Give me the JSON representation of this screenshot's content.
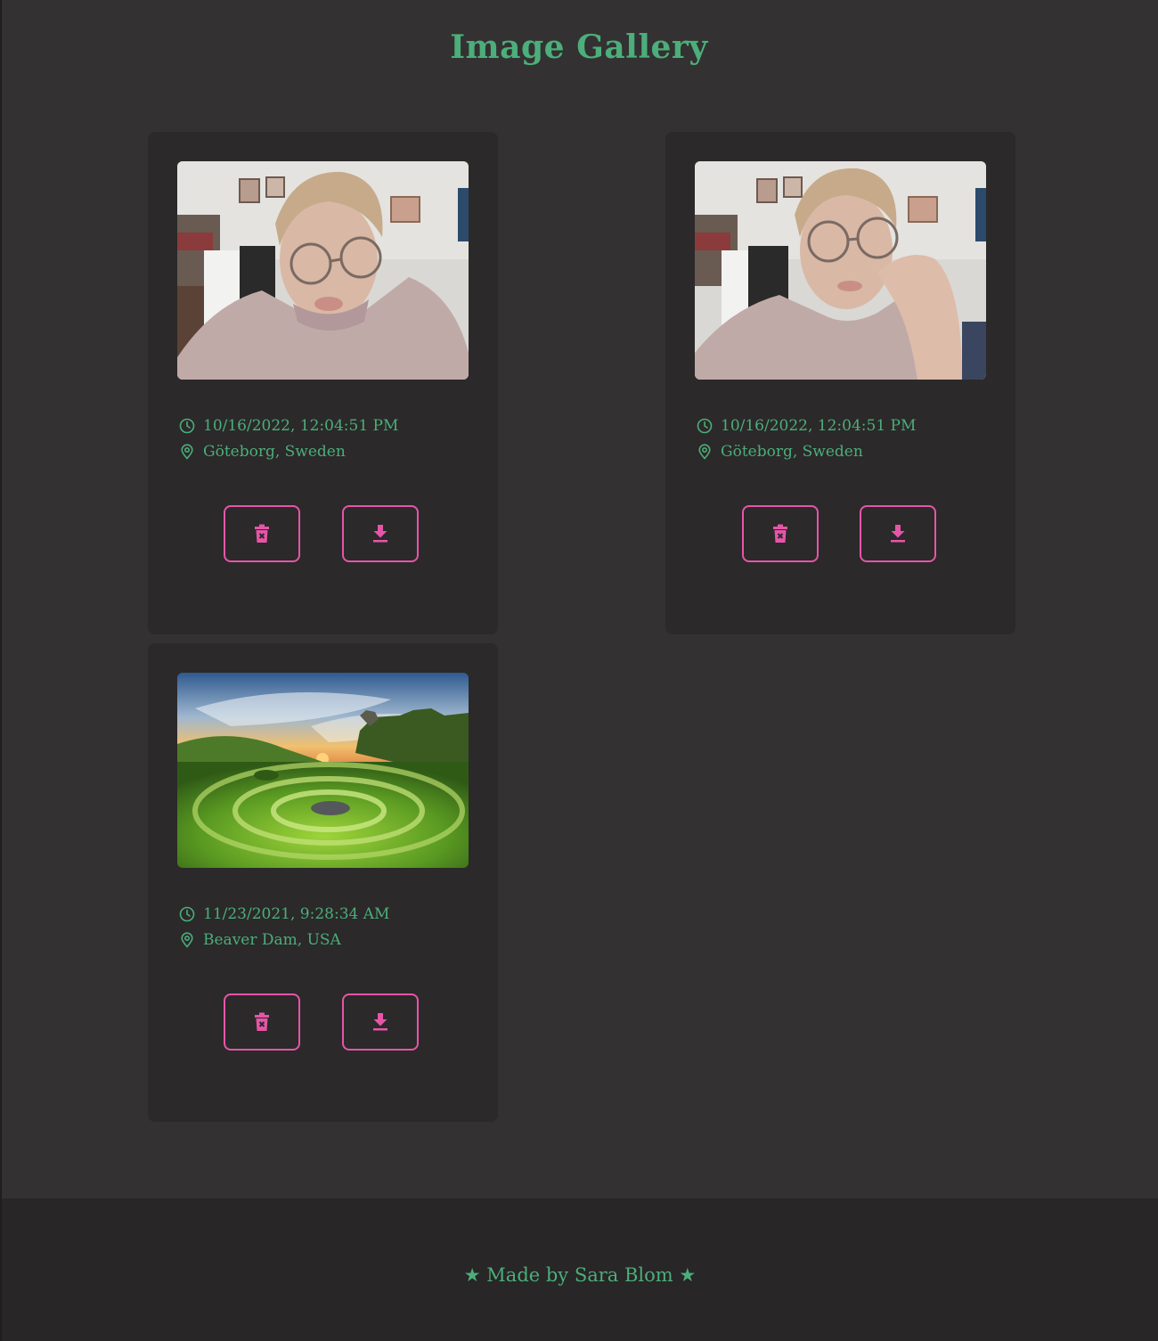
{
  "header": {
    "title": "Image Gallery"
  },
  "colors": {
    "background": "#333132",
    "card": "#2b292a",
    "accent_green": "#4cae7a",
    "accent_pink": "#e655a8",
    "footer": "#282627"
  },
  "gallery": {
    "cards": [
      {
        "photo": "selfie-portrait",
        "timestamp": "10/16/2022, 12:04:51 PM",
        "location": "Göteborg, Sweden",
        "delete_icon": "trash-icon",
        "download_icon": "download-icon"
      },
      {
        "photo": "selfie-portrait-hand",
        "timestamp": "10/16/2022, 12:04:51 PM",
        "location": "Göteborg, Sweden",
        "delete_icon": "trash-icon",
        "download_icon": "download-icon"
      },
      {
        "photo": "green-valley-landscape",
        "timestamp": "11/23/2021, 9:28:34 AM",
        "location": "Beaver Dam, USA",
        "delete_icon": "trash-icon",
        "download_icon": "download-icon"
      }
    ]
  },
  "footer": {
    "text": "★ Made by Sara Blom ★"
  }
}
